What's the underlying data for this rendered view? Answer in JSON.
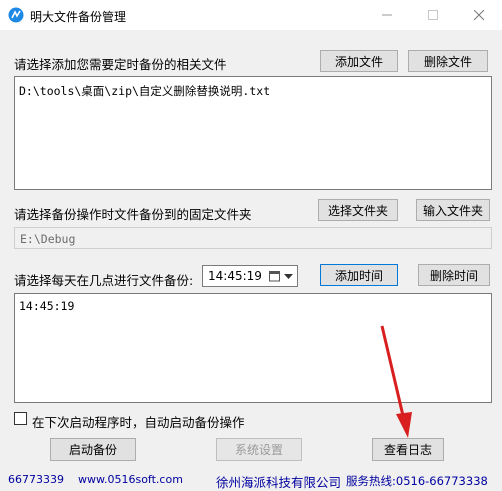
{
  "window": {
    "title": "明大文件备份管理",
    "icon": "app-icon"
  },
  "files_section": {
    "label": "请选择添加您需要定时备份的相关文件",
    "add_button": "添加文件",
    "delete_button": "删除文件",
    "items": [
      "D:\\tools\\桌面\\zip\\自定义删除替换说明.txt"
    ]
  },
  "folder_section": {
    "label": "请选择备份操作时文件备份到的固定文件夹",
    "select_button": "选择文件夹",
    "input_button": "输入文件夹",
    "value": "E:\\Debug"
  },
  "time_section": {
    "label": "请选择每天在几点进行文件备份:",
    "time_value": "14:45:19",
    "add_button": "添加时间",
    "delete_button": "删除时间",
    "items": [
      "14:45:19"
    ]
  },
  "autostart": {
    "label": "在下次启动程序时，自动启动备份操作",
    "checked": false
  },
  "actions": {
    "start_button": "启动备份",
    "settings_button": "系统设置",
    "log_button": "查看日志"
  },
  "footer": {
    "phone": "66773339",
    "website": "www.0516soft.com",
    "company": "徐州海派科技有限公司",
    "hotline": "服务热线:0516-66773338"
  },
  "colors": {
    "accent": "#0078d7",
    "annotation_arrow": "#d81e1e",
    "footer_text": "#0000a0"
  }
}
